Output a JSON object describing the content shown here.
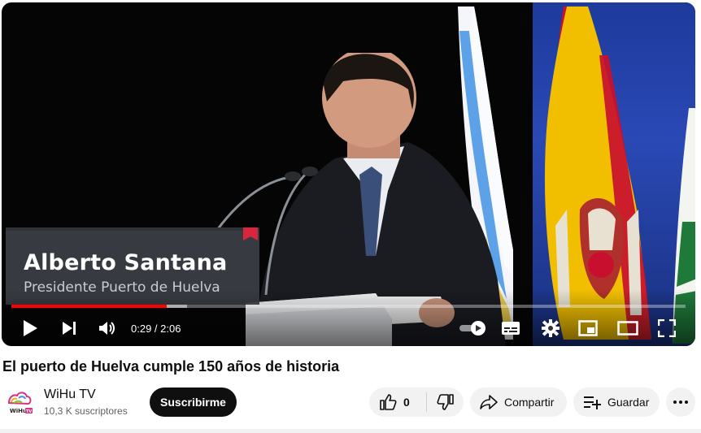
{
  "video": {
    "lower_third_name": "Alberto Santana",
    "lower_third_role": "Presidente Puerto de Huelva",
    "current_time": "0:29",
    "duration": "2:06",
    "time_display": "0:29 / 2:06",
    "progress_fraction": 0.23,
    "buffer_fraction": 0.26,
    "controls": [
      "play-icon",
      "next-icon",
      "volume-icon",
      "autoplay-toggle",
      "subtitles-icon",
      "settings-icon",
      "miniplayer-icon",
      "theater-icon",
      "fullscreen-icon"
    ]
  },
  "title": "El puerto de Huelva cumple 150 años de historia",
  "channel": {
    "name": "WiHu TV",
    "subscribers": "10,3 K suscriptores",
    "avatar_text": "WiHu TV"
  },
  "actions": {
    "subscribe_label": "Suscribirme",
    "like_count": "0",
    "share_label": "Compartir",
    "save_label": "Guardar"
  },
  "colors": {
    "progress": "#ff0000",
    "subscribe_bg": "#0f0f0f",
    "pill_bg": "#f2f2f2"
  }
}
